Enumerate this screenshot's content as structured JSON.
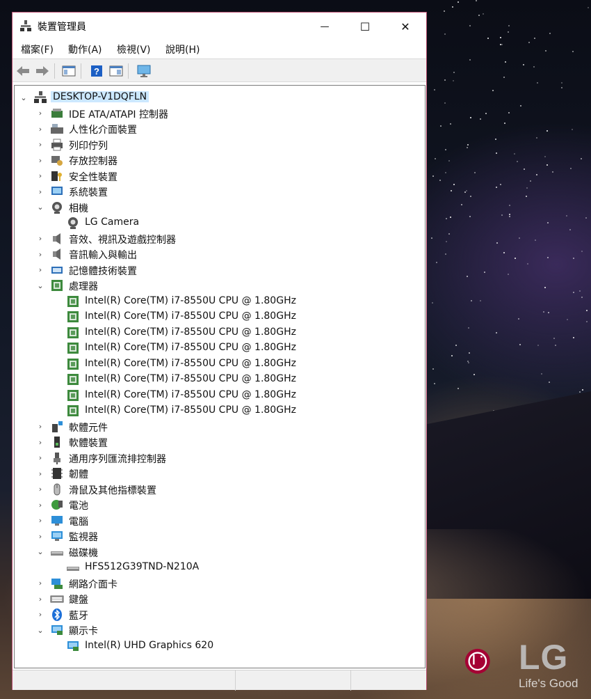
{
  "window": {
    "title": "裝置管理員",
    "minimize_glyph": "—",
    "maximize_glyph": "☐",
    "close_glyph": "✕"
  },
  "menu": [
    "檔案(F)",
    "動作(A)",
    "檢視(V)",
    "說明(H)"
  ],
  "toolbar": [
    "back-icon",
    "forward-icon",
    "properties-icon",
    "help-icon",
    "action-pane-icon",
    "monitor-icon"
  ],
  "tree": {
    "root": "DESKTOP-V1DQFLN",
    "items": [
      {
        "label": "IDE ATA/ATAPI 控制器",
        "icon": "ide-controller-icon",
        "depth": 1,
        "expand": "collapsed"
      },
      {
        "label": "人性化介面裝置",
        "icon": "hid-icon",
        "depth": 1,
        "expand": "collapsed"
      },
      {
        "label": "列印佇列",
        "icon": "printer-icon",
        "depth": 1,
        "expand": "collapsed"
      },
      {
        "label": "存放控制器",
        "icon": "storage-controller-icon",
        "depth": 1,
        "expand": "collapsed"
      },
      {
        "label": "安全性裝置",
        "icon": "security-device-icon",
        "depth": 1,
        "expand": "collapsed"
      },
      {
        "label": "系統裝置",
        "icon": "system-device-icon",
        "depth": 1,
        "expand": "collapsed"
      },
      {
        "label": "相機",
        "icon": "camera-icon",
        "depth": 1,
        "expand": "expanded"
      },
      {
        "label": "LG Camera",
        "icon": "camera-icon",
        "depth": 2,
        "expand": "none"
      },
      {
        "label": "音效、視訊及遊戲控制器",
        "icon": "speaker-icon",
        "depth": 1,
        "expand": "collapsed"
      },
      {
        "label": "音訊輸入與輸出",
        "icon": "speaker-icon",
        "depth": 1,
        "expand": "collapsed"
      },
      {
        "label": "記憶體技術裝置",
        "icon": "memory-icon",
        "depth": 1,
        "expand": "collapsed"
      },
      {
        "label": "處理器",
        "icon": "processor-icon",
        "depth": 1,
        "expand": "expanded"
      },
      {
        "label": "Intel(R) Core(TM) i7-8550U CPU @ 1.80GHz",
        "icon": "processor-icon",
        "depth": 2,
        "expand": "none"
      },
      {
        "label": "Intel(R) Core(TM) i7-8550U CPU @ 1.80GHz",
        "icon": "processor-icon",
        "depth": 2,
        "expand": "none"
      },
      {
        "label": "Intel(R) Core(TM) i7-8550U CPU @ 1.80GHz",
        "icon": "processor-icon",
        "depth": 2,
        "expand": "none"
      },
      {
        "label": "Intel(R) Core(TM) i7-8550U CPU @ 1.80GHz",
        "icon": "processor-icon",
        "depth": 2,
        "expand": "none"
      },
      {
        "label": "Intel(R) Core(TM) i7-8550U CPU @ 1.80GHz",
        "icon": "processor-icon",
        "depth": 2,
        "expand": "none"
      },
      {
        "label": "Intel(R) Core(TM) i7-8550U CPU @ 1.80GHz",
        "icon": "processor-icon",
        "depth": 2,
        "expand": "none"
      },
      {
        "label": "Intel(R) Core(TM) i7-8550U CPU @ 1.80GHz",
        "icon": "processor-icon",
        "depth": 2,
        "expand": "none"
      },
      {
        "label": "Intel(R) Core(TM) i7-8550U CPU @ 1.80GHz",
        "icon": "processor-icon",
        "depth": 2,
        "expand": "none"
      },
      {
        "label": "軟體元件",
        "icon": "software-component-icon",
        "depth": 1,
        "expand": "collapsed"
      },
      {
        "label": "軟體裝置",
        "icon": "software-device-icon",
        "depth": 1,
        "expand": "collapsed"
      },
      {
        "label": "通用序列匯流排控制器",
        "icon": "usb-icon",
        "depth": 1,
        "expand": "collapsed"
      },
      {
        "label": "韌體",
        "icon": "firmware-icon",
        "depth": 1,
        "expand": "collapsed"
      },
      {
        "label": "滑鼠及其他指標裝置",
        "icon": "mouse-icon",
        "depth": 1,
        "expand": "collapsed"
      },
      {
        "label": "電池",
        "icon": "battery-icon",
        "depth": 1,
        "expand": "collapsed"
      },
      {
        "label": "電腦",
        "icon": "computer-icon",
        "depth": 1,
        "expand": "collapsed"
      },
      {
        "label": "監視器",
        "icon": "monitor-icon",
        "depth": 1,
        "expand": "collapsed"
      },
      {
        "label": "磁碟機",
        "icon": "disk-drive-icon",
        "depth": 1,
        "expand": "expanded"
      },
      {
        "label": "HFS512G39TND-N210A",
        "icon": "disk-drive-icon",
        "depth": 2,
        "expand": "none"
      },
      {
        "label": "網路介面卡",
        "icon": "network-adapter-icon",
        "depth": 1,
        "expand": "collapsed"
      },
      {
        "label": "鍵盤",
        "icon": "keyboard-icon",
        "depth": 1,
        "expand": "collapsed"
      },
      {
        "label": "藍牙",
        "icon": "bluetooth-icon",
        "depth": 1,
        "expand": "collapsed"
      },
      {
        "label": "顯示卡",
        "icon": "display-adapter-icon",
        "depth": 1,
        "expand": "expanded"
      },
      {
        "label": "Intel(R) UHD Graphics 620",
        "icon": "display-adapter-icon",
        "depth": 2,
        "expand": "none"
      }
    ]
  },
  "brand": {
    "name": "LG",
    "tagline": "Life's Good",
    "accent": "#a50034"
  }
}
